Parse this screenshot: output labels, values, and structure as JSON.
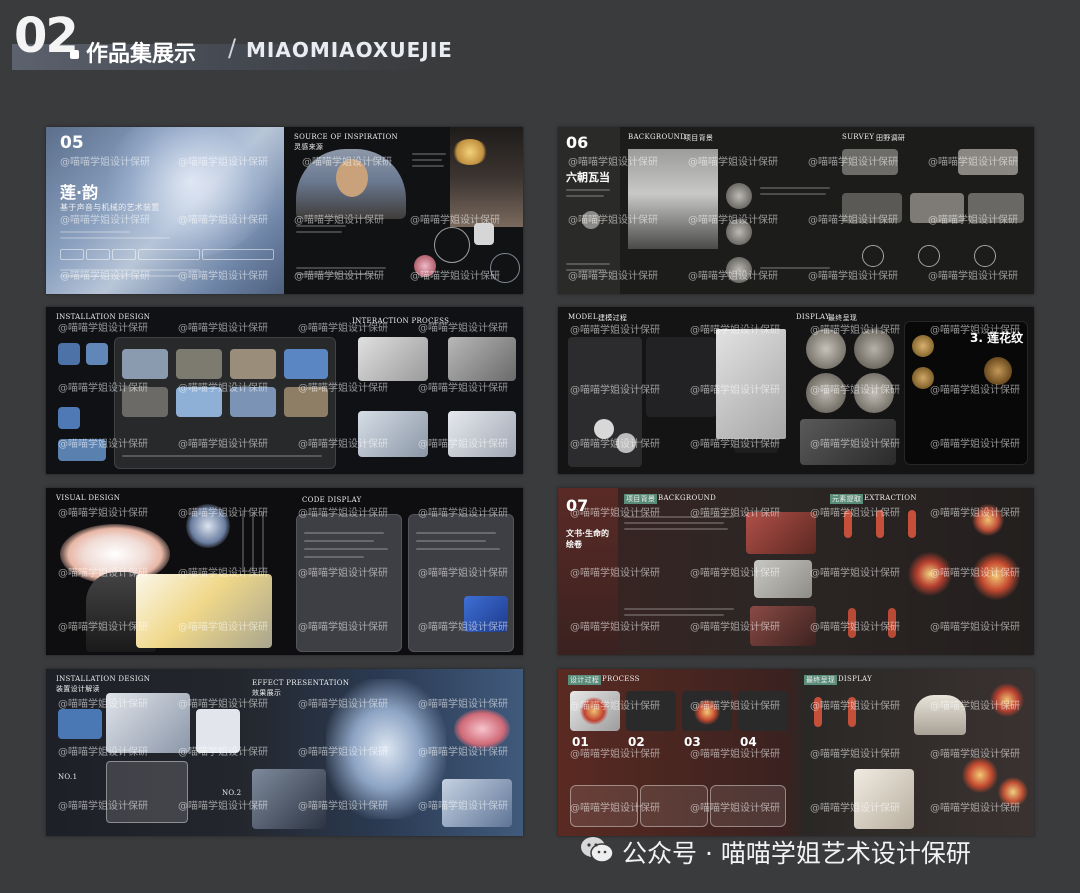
{
  "header": {
    "number": "02",
    "title": "作品集展示",
    "separator": "/",
    "subtitle": "MIAOMIAOXUEJIE"
  },
  "watermark": "@喵喵学姐设计保研",
  "panels": {
    "p05": {
      "number": "05",
      "title": "莲·韵",
      "subtitle": "基于声音与机械的艺术装置",
      "tag_source": "SOURCE OF INSPIRATION",
      "tag_source_cn": "灵感来源"
    },
    "p06": {
      "number": "06",
      "title": "六朝瓦当",
      "tag_background": "BACKGROUND",
      "tag_background_cn": "项目背景",
      "tag_survey": "SURVEY",
      "tag_survey_cn": "田野调研"
    },
    "install1": {
      "tag_design": "INSTALLATION DESIGN",
      "tag_interaction": "INTERACTION PROCESS"
    },
    "model": {
      "tag_model": "MODEL",
      "tag_model_cn": "建模过程",
      "tag_display": "DISPLAY",
      "tag_display_cn": "最终呈现",
      "label_flower": "3. 莲花纹"
    },
    "visual": {
      "tag_visual": "VISUAL DESIGN",
      "tag_code": "CODE DISPLAY"
    },
    "p07": {
      "number": "07",
      "title": "文书·生命的绘卷",
      "tag_background": "项目背景",
      "tag_background_en": "BACKGROUND",
      "tag_extraction": "元素提取",
      "tag_extraction_en": "EXTRACTION"
    },
    "install2": {
      "tag_design": "INSTALLATION DESIGN",
      "tag_design_cn": "装置设计解读",
      "tag_effect": "EFFECT PRESENTATION",
      "tag_effect_cn": "效果展示",
      "no1": "NO.1",
      "no2": "NO.2"
    },
    "process": {
      "tag_process": "设计过程",
      "tag_process_en": "PROCESS",
      "tag_display": "最终呈现",
      "tag_display_en": "DISPLAY",
      "step1": "01",
      "step2": "02",
      "step3": "03",
      "step4": "04"
    }
  },
  "footer": {
    "icon": "wechat-icon",
    "text": "公众号 · 喵喵学姐艺术设计保研"
  }
}
